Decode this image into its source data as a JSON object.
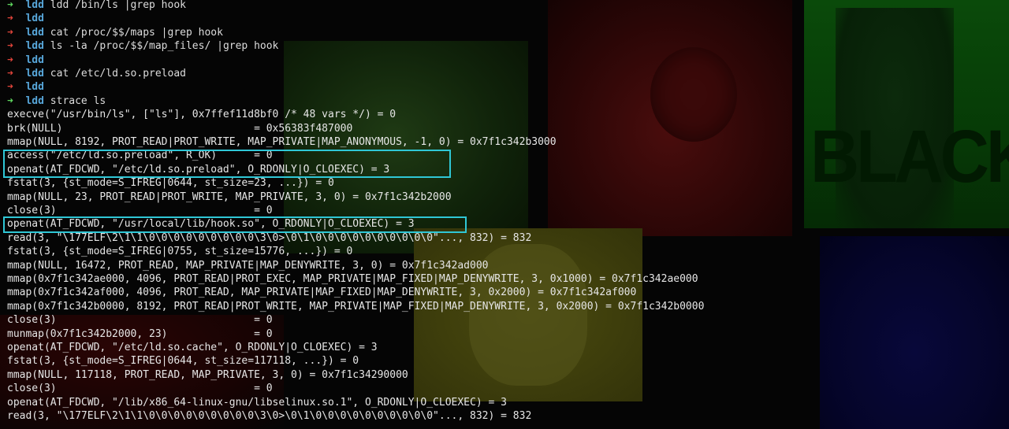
{
  "background": {
    "panel_colors": [
      "#1f3a14",
      "#4a0d0d",
      "#0a4a0a",
      "#08083a",
      "#4a4a10"
    ],
    "poster_text": "BLACK"
  },
  "colors": {
    "prompt_ok": "#5fd75f",
    "prompt_err": "#e0443a",
    "prompt_dir": "#57a6d9",
    "highlight_box": "#2fc7d6"
  },
  "commands": [
    {
      "status": "ok",
      "arrow": "➜",
      "dir": "ldd",
      "cmd": "ldd /bin/ls |grep hook"
    },
    {
      "status": "err",
      "arrow": "➜",
      "dir": "ldd",
      "cmd": ""
    },
    {
      "status": "err",
      "arrow": "➜",
      "dir": "ldd",
      "cmd": "cat /proc/$$/maps |grep hook"
    },
    {
      "status": "err",
      "arrow": "➜",
      "dir": "ldd",
      "cmd": "ls -la /proc/$$/map_files/ |grep hook"
    },
    {
      "status": "err",
      "arrow": "➜",
      "dir": "ldd",
      "cmd": ""
    },
    {
      "status": "err",
      "arrow": "➜",
      "dir": "ldd",
      "cmd": "cat /etc/ld.so.preload"
    },
    {
      "status": "err",
      "arrow": "➜",
      "dir": "ldd",
      "cmd": ""
    },
    {
      "status": "ok",
      "arrow": "➜",
      "dir": "ldd",
      "cmd": "strace ls"
    }
  ],
  "output": [
    "execve(\"/usr/bin/ls\", [\"ls\"], 0x7ffef11d8bf0 /* 48 vars */) = 0",
    "brk(NULL)                               = 0x56383f487000",
    "mmap(NULL, 8192, PROT_READ|PROT_WRITE, MAP_PRIVATE|MAP_ANONYMOUS, -1, 0) = 0x7f1c342b3000",
    "access(\"/etc/ld.so.preload\", R_OK)      = 0",
    "openat(AT_FDCWD, \"/etc/ld.so.preload\", O_RDONLY|O_CLOEXEC) = 3",
    "fstat(3, {st_mode=S_IFREG|0644, st_size=23, ...}) = 0",
    "mmap(NULL, 23, PROT_READ|PROT_WRITE, MAP_PRIVATE, 3, 0) = 0x7f1c342b2000",
    "close(3)                                = 0",
    "openat(AT_FDCWD, \"/usr/local/lib/hook.so\", O_RDONLY|O_CLOEXEC) = 3",
    "read(3, \"\\177ELF\\2\\1\\1\\0\\0\\0\\0\\0\\0\\0\\0\\0\\3\\0>\\0\\1\\0\\0\\0\\0\\0\\0\\0\\0\\0\\0\"..., 832) = 832",
    "fstat(3, {st_mode=S_IFREG|0755, st_size=15776, ...}) = 0",
    "mmap(NULL, 16472, PROT_READ, MAP_PRIVATE|MAP_DENYWRITE, 3, 0) = 0x7f1c342ad000",
    "mmap(0x7f1c342ae000, 4096, PROT_READ|PROT_EXEC, MAP_PRIVATE|MAP_FIXED|MAP_DENYWRITE, 3, 0x1000) = 0x7f1c342ae000",
    "mmap(0x7f1c342af000, 4096, PROT_READ, MAP_PRIVATE|MAP_FIXED|MAP_DENYWRITE, 3, 0x2000) = 0x7f1c342af000",
    "mmap(0x7f1c342b0000, 8192, PROT_READ|PROT_WRITE, MAP_PRIVATE|MAP_FIXED|MAP_DENYWRITE, 3, 0x2000) = 0x7f1c342b0000",
    "close(3)                                = 0",
    "munmap(0x7f1c342b2000, 23)              = 0",
    "openat(AT_FDCWD, \"/etc/ld.so.cache\", O_RDONLY|O_CLOEXEC) = 3",
    "fstat(3, {st_mode=S_IFREG|0644, st_size=117118, ...}) = 0",
    "mmap(NULL, 117118, PROT_READ, MAP_PRIVATE, 3, 0) = 0x7f1c34290000",
    "close(3)                                = 0",
    "openat(AT_FDCWD, \"/lib/x86_64-linux-gnu/libselinux.so.1\", O_RDONLY|O_CLOEXEC) = 3",
    "read(3, \"\\177ELF\\2\\1\\1\\0\\0\\0\\0\\0\\0\\0\\0\\0\\3\\0>\\0\\1\\0\\0\\0\\0\\0\\0\\0\\0\\0\\0\"..., 832) = 832"
  ]
}
